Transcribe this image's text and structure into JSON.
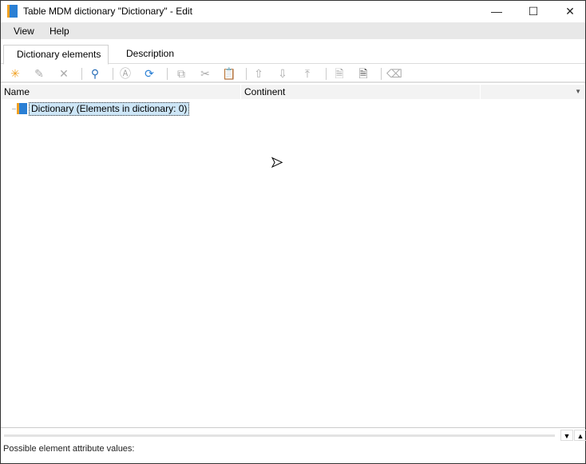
{
  "window": {
    "title": "Table MDM dictionary \"Dictionary\" - Edit",
    "minimize": "—",
    "maximize": "☐",
    "close": "✕"
  },
  "menu": [
    "View",
    "Help"
  ],
  "tabs": [
    {
      "label": "Dictionary elements",
      "active": true
    },
    {
      "label": "Description",
      "active": false
    }
  ],
  "toolbar": [
    "new-element",
    "edit",
    "delete",
    "find",
    "replace",
    "refresh",
    "copy",
    "cut",
    "paste",
    "move-up",
    "move-down",
    "move-to-top",
    "export",
    "import",
    "clear"
  ],
  "columns": [
    "Name",
    "Continent"
  ],
  "tree": {
    "root_label": "Dictionary (Elements in dictionary: 0)"
  },
  "bottom": {
    "label": "Possible element attribute values:"
  }
}
